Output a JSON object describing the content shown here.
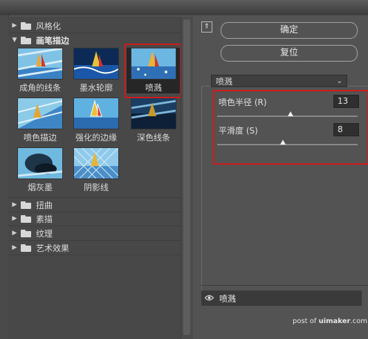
{
  "gallery": {
    "categories_top": [
      {
        "label": "风格化",
        "expanded": false
      },
      {
        "label": "画笔描边",
        "expanded": true
      }
    ],
    "thumbnails": [
      {
        "label": "成角的线条",
        "icon": "angled-strokes-thumbnail"
      },
      {
        "label": "墨水轮廓",
        "icon": "ink-outlines-thumbnail"
      },
      {
        "label": "喷溅",
        "icon": "spatter-thumbnail",
        "selected": true
      },
      {
        "label": "喷色描边",
        "icon": "sprayed-strokes-thumbnail"
      },
      {
        "label": "强化的边缘",
        "icon": "accented-edges-thumbnail"
      },
      {
        "label": "深色线条",
        "icon": "dark-strokes-thumbnail"
      },
      {
        "label": "烟灰墨",
        "icon": "sumi-e-thumbnail"
      },
      {
        "label": "阴影线",
        "icon": "crosshatch-thumbnail"
      }
    ],
    "categories_bottom": [
      {
        "label": "扭曲",
        "expanded": false
      },
      {
        "label": "素描",
        "expanded": false
      },
      {
        "label": "纹理",
        "expanded": false
      },
      {
        "label": "艺术效果",
        "expanded": false
      }
    ]
  },
  "buttons": {
    "ok": "确定",
    "reset": "复位",
    "collapse_icon": "collapse-up-icon"
  },
  "filter_select": {
    "value": "喷溅"
  },
  "params": [
    {
      "label": "喷色半径 (R)",
      "value": "13",
      "slider_fraction": 0.52
    },
    {
      "label": "平滑度 (S)",
      "value": "8",
      "slider_fraction": 0.47
    }
  ],
  "layer": {
    "name": "喷溅",
    "eye_icon": "eye-icon"
  },
  "watermark": {
    "prefix": "post of ",
    "brand": "uimaker",
    "suffix": ".com"
  },
  "colors": {
    "highlight": "#d41818",
    "panel": "#535353"
  }
}
